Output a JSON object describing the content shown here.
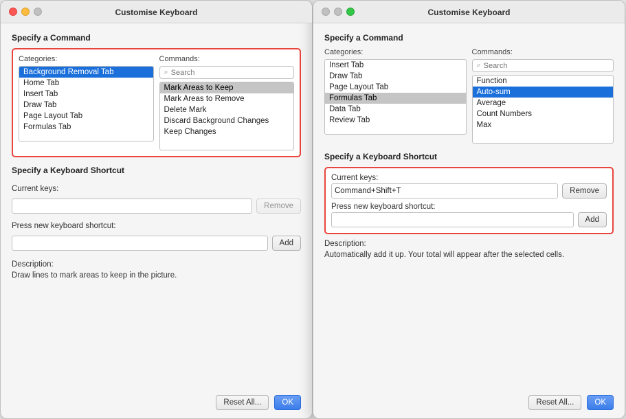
{
  "left_dialog": {
    "title": "Customise Keyboard",
    "traffic_lights": [
      "close",
      "minimize",
      "maximize"
    ],
    "specify_command": {
      "section_label": "Specify a Command",
      "categories_label": "Categories:",
      "commands_label": "Commands:",
      "search_placeholder": "Search",
      "categories": [
        {
          "label": "Background Removal Tab",
          "selected": true
        },
        {
          "label": "Home Tab",
          "selected": false
        },
        {
          "label": "Insert Tab",
          "selected": false
        },
        {
          "label": "Draw Tab",
          "selected": false
        },
        {
          "label": "Page Layout Tab",
          "selected": false
        },
        {
          "label": "Formulas Tab",
          "selected": false
        }
      ],
      "commands": [
        {
          "label": "Mark Areas to Keep",
          "selected": true
        },
        {
          "label": "Mark Areas to Remove",
          "selected": false
        },
        {
          "label": "Delete Mark",
          "selected": false
        },
        {
          "label": "Discard Background Changes",
          "selected": false
        },
        {
          "label": "Keep Changes",
          "selected": false
        }
      ]
    },
    "specify_shortcut": {
      "section_label": "Specify a Keyboard Shortcut",
      "current_keys_label": "Current keys:",
      "current_keys_value": "",
      "remove_label": "Remove",
      "press_new_label": "Press new keyboard shortcut:",
      "press_new_value": "",
      "add_label": "Add",
      "description_label": "Description:",
      "description_text": "Draw lines to mark areas to keep in the picture."
    },
    "footer": {
      "reset_label": "Reset All...",
      "ok_label": "OK"
    }
  },
  "right_dialog": {
    "title": "Customise Keyboard",
    "traffic_lights": [
      "close_inactive",
      "minimize_inactive",
      "maximize"
    ],
    "specify_command": {
      "section_label": "Specify a Command",
      "categories_label": "Categories:",
      "commands_label": "Commands:",
      "search_placeholder": "Search",
      "categories": [
        {
          "label": "Insert Tab",
          "selected": false
        },
        {
          "label": "Draw Tab",
          "selected": false
        },
        {
          "label": "Page Layout Tab",
          "selected": false
        },
        {
          "label": "Formulas Tab",
          "selected": true
        },
        {
          "label": "Data Tab",
          "selected": false
        },
        {
          "label": "Review Tab",
          "selected": false
        }
      ],
      "commands": [
        {
          "label": "Function",
          "selected": false
        },
        {
          "label": "Auto-sum",
          "selected": true
        },
        {
          "label": "Average",
          "selected": false
        },
        {
          "label": "Count Numbers",
          "selected": false
        },
        {
          "label": "Max",
          "selected": false
        }
      ]
    },
    "specify_shortcut": {
      "section_label": "Specify a Keyboard Shortcut",
      "current_keys_label": "Current keys:",
      "current_keys_value": "Command+Shift+T",
      "remove_label": "Remove",
      "press_new_label": "Press new keyboard shortcut:",
      "press_new_value": "",
      "add_label": "Add",
      "description_label": "Description:",
      "description_text": "Automatically add it up. Your total will appear after the selected cells."
    },
    "footer": {
      "reset_label": "Reset All...",
      "ok_label": "OK"
    }
  }
}
